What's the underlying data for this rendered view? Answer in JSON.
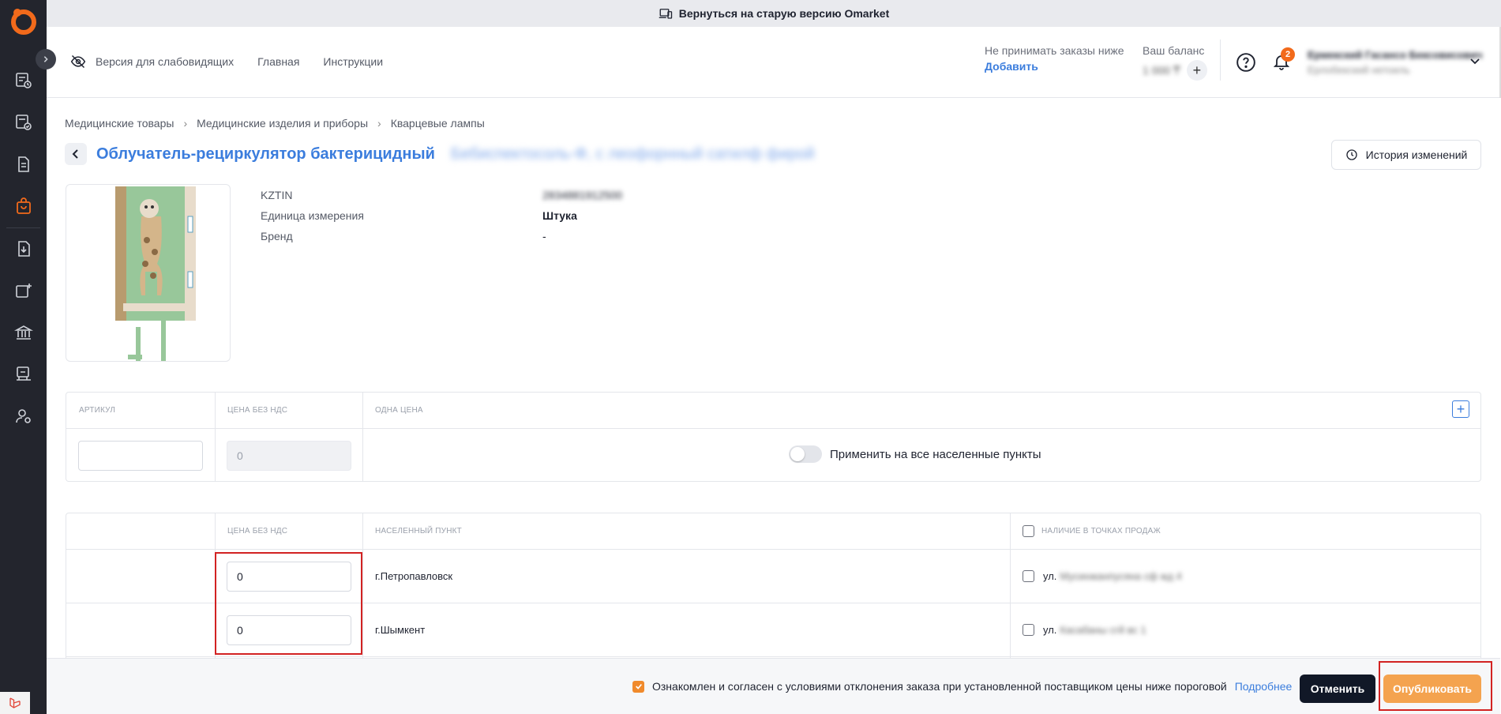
{
  "banner": {
    "text": "Вернуться на старую версию Omarket"
  },
  "header": {
    "accessibility_label": "Версия для слабовидящих",
    "nav": [
      "Главная",
      "Инструкции"
    ],
    "min_order_label": "Не принимать заказы ниже",
    "min_order_action": "Добавить",
    "balance_label": "Ваш баланс",
    "balance_value": "1 000 ₸",
    "notifications_count": "2",
    "user_name": "Ермекский Гасансо Бексовисович",
    "user_role": "Ерлобекский нетоиль"
  },
  "breadcrumb": [
    "Медицинские товары",
    "Медицинские изделия и приборы",
    "Кварцевые лампы"
  ],
  "product": {
    "title": "Облучатель-рециркулятор бактерицидный",
    "title_hidden": "Бебиспектосоль-Ф, с леофорнный сатилф фирой",
    "history_button": "История изменений",
    "attributes": [
      {
        "key": "KZTIN",
        "value": "2834881912500"
      },
      {
        "key": "Единица измерения",
        "value": "Штука"
      },
      {
        "key": "Бренд",
        "value": "-"
      }
    ]
  },
  "price_table": {
    "headers": [
      "Артикул",
      "Цена без НДС",
      "Одна цена"
    ],
    "article_value": "",
    "price_value": "0",
    "apply_all_label": "Применить на все населенные пункты"
  },
  "city_table": {
    "headers": [
      "",
      "Цена без НДС",
      "Населенный пункт",
      "Наличие в точках продаж"
    ],
    "rows": [
      {
        "price": "0",
        "city": "г.Петропавловск",
        "addr_prefix": "ул.",
        "addr_hidden": "Мусинжанпусяна сф жд 4"
      },
      {
        "price": "0",
        "city": "г.Шымкент",
        "addr_prefix": "ул.",
        "addr_hidden": "Касабаны сгй вс 1"
      }
    ]
  },
  "footer": {
    "agree_text": "Ознакомлен и согласен с условиями отклонения заказа при установленной поставщиком цены ниже пороговой",
    "more_link": "Подробнее",
    "cancel": "Отменить",
    "publish": "Опубликовать"
  },
  "colors": {
    "accent_blue": "#3b7ddd",
    "brand_orange": "#f26a1b",
    "publish": "#f4a34f",
    "sidebar": "#23252d",
    "highlight": "#d22222"
  }
}
